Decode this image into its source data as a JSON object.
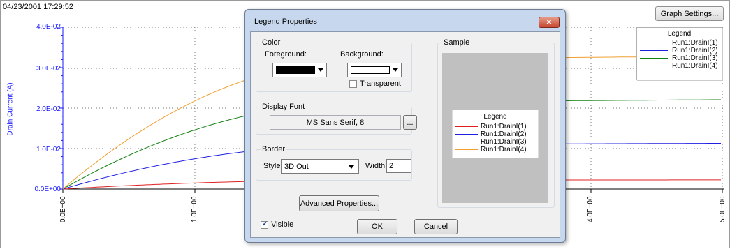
{
  "graph": {
    "timestamp": "04/23/2001 17:29:52",
    "settings_button": "Graph Settings...",
    "y_axis_title": "Drain Current (A)",
    "y_tick_labels": [
      "4.0E-02",
      "3.0E-02",
      "2.0E-02",
      "1.0E-02",
      "0.0E+00"
    ],
    "x_tick_labels": [
      "0.0E+00",
      "1.0E+00",
      "4.0E+00",
      "5.0E+00"
    ],
    "legend": {
      "title": "Legend",
      "items": [
        {
          "label": "Run1:DrainI(1)",
          "color": "#e02020"
        },
        {
          "label": "Run1:DrainI(2)",
          "color": "#2020e0"
        },
        {
          "label": "Run1:DrainI(3)",
          "color": "#108010"
        },
        {
          "label": "Run1:DrainI(4)",
          "color": "#f0a030"
        }
      ]
    },
    "colors": {
      "axis": "#1a1aff",
      "grid": "#777777"
    }
  },
  "dialog": {
    "title": "Legend Properties",
    "close_icon": "close-icon",
    "color_group": {
      "label": "Color",
      "foreground_label": "Foreground:",
      "foreground_color": "#000000",
      "background_label": "Background:",
      "background_color": "#ffffff",
      "transparent_label": "Transparent",
      "transparent_checked": false
    },
    "font_group": {
      "label": "Display Font",
      "value": "MS Sans Serif, 8",
      "browse_button": "..."
    },
    "border_group": {
      "label": "Border",
      "style_label": "Style",
      "style_value": "3D Out",
      "width_label": "Width",
      "width_value": "2"
    },
    "advanced_button": "Advanced Properties...",
    "sample_label": "Sample",
    "visible_label": "Visible",
    "visible_checked": true,
    "ok_button": "OK",
    "cancel_button": "Cancel"
  }
}
